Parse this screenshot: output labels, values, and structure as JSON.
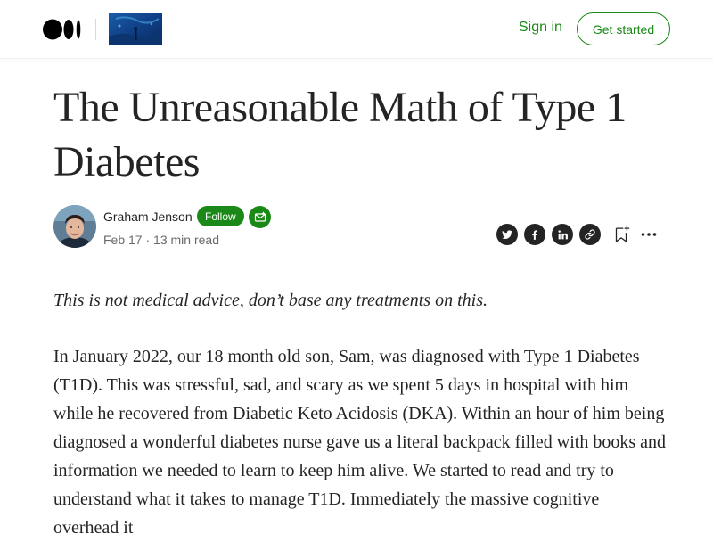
{
  "header": {
    "logo_icon": "medium-logo-icon",
    "publication_icon": "publication-thumbnail-icon",
    "sign_in_label": "Sign in",
    "get_started_label": "Get started",
    "accent_color": "#1a8917"
  },
  "article": {
    "title": "The Unreasonable Math of Type 1 Diabetes",
    "author": {
      "name": "Graham Jenson",
      "follow_label": "Follow",
      "subscribe_icon": "subscribe-mail-icon",
      "date": "Feb 17",
      "separator": "·",
      "read_time": "13 min read"
    },
    "actions": {
      "share_icons": [
        "twitter-icon",
        "facebook-icon",
        "linkedin-icon",
        "link-icon"
      ],
      "save_icon": "bookmark-add-icon",
      "more_icon": "more-icon"
    },
    "disclaimer": "This is not medical advice, don’t base any treatments on this.",
    "body_paragraph": "In January 2022, our 18 month old son, Sam, was diagnosed with Type 1 Diabetes (T1D). This was stressful, sad, and scary as we spent 5 days in hospital with him while he recovered from Diabetic Keto Acidosis (DKA). Within an hour of him being diagnosed a wonderful diabetes nurse gave us a literal backpack filled with books and information we needed to learn to keep him alive. We started to read and try to understand what it takes to manage T1D. Immediately the massive cognitive overhead it"
  }
}
